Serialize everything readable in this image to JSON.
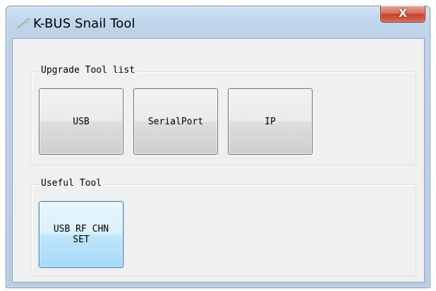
{
  "window": {
    "title": "K-BUS Snail Tool",
    "close_icon": "close-x-icon",
    "close_glyph": "X",
    "app_icon": "snail-icon"
  },
  "groups": {
    "upgrade": {
      "label": "Upgrade Tool list",
      "buttons": [
        {
          "label": "USB"
        },
        {
          "label": "SerialPort"
        },
        {
          "label": "IP"
        }
      ]
    },
    "useful": {
      "label": "Useful Tool",
      "buttons": [
        {
          "label": "USB RF CHN\nSET",
          "focused": true
        }
      ]
    }
  },
  "colors": {
    "close_button_red": "#c5432d",
    "focused_button_blue": "#3c7fb1",
    "frame_blue": "#bcd3ea"
  }
}
